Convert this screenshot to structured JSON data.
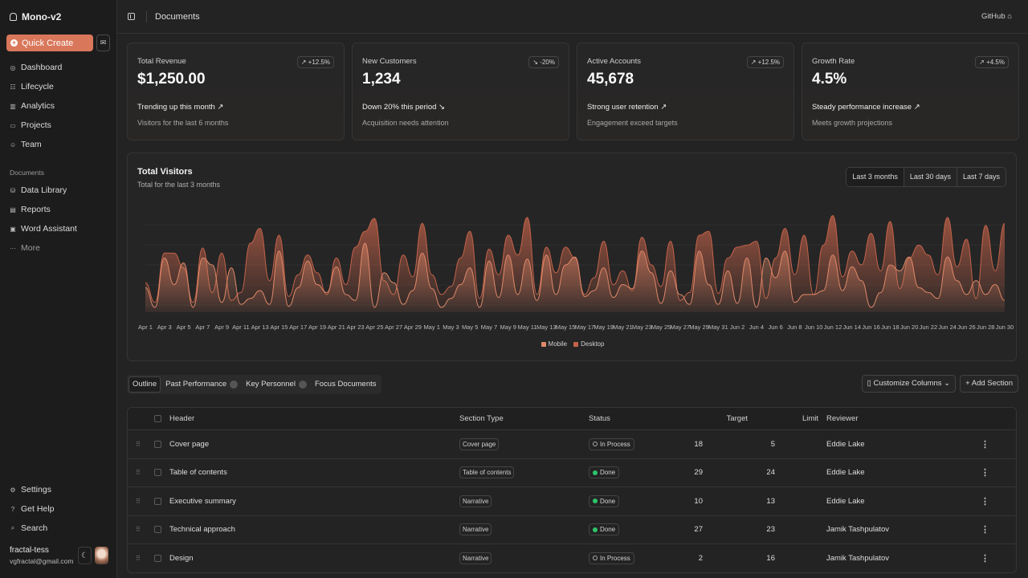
{
  "brand": {
    "name": "Mono-v2"
  },
  "sidebar": {
    "quick_create": "Quick Create",
    "nav": [
      {
        "label": "Dashboard",
        "icon": "dashboard-icon"
      },
      {
        "label": "Lifecycle",
        "icon": "list-icon"
      },
      {
        "label": "Analytics",
        "icon": "chart-icon"
      },
      {
        "label": "Projects",
        "icon": "folder-icon"
      },
      {
        "label": "Team",
        "icon": "users-icon"
      }
    ],
    "documents_label": "Documents",
    "docs": [
      {
        "label": "Data Library",
        "icon": "database-icon"
      },
      {
        "label": "Reports",
        "icon": "report-icon"
      },
      {
        "label": "Word Assistant",
        "icon": "file-word-icon"
      },
      {
        "label": "More",
        "icon": "more-icon"
      }
    ],
    "bottom": [
      {
        "label": "Settings",
        "icon": "gear-icon"
      },
      {
        "label": "Get Help",
        "icon": "help-icon"
      },
      {
        "label": "Search",
        "icon": "search-icon"
      }
    ],
    "user": {
      "name": "fractal-tess",
      "email": "vgfractal@gmail.com"
    }
  },
  "topbar": {
    "title": "Documents",
    "github": "GitHub"
  },
  "cards": [
    {
      "label": "Total Revenue",
      "value": "$1,250.00",
      "badge": "↗ +12.5%",
      "trend": "Trending up this month ↗",
      "sub": "Visitors for the last 6 months"
    },
    {
      "label": "New Customers",
      "value": "1,234",
      "badge": "↘ -20%",
      "trend": "Down 20% this period ↘",
      "sub": "Acquisition needs attention"
    },
    {
      "label": "Active Accounts",
      "value": "45,678",
      "badge": "↗ +12.5%",
      "trend": "Strong user retention ↗",
      "sub": "Engagement exceed targets"
    },
    {
      "label": "Growth Rate",
      "value": "4.5%",
      "badge": "↗ +4.5%",
      "trend": "Steady performance increase ↗",
      "sub": "Meets growth projections"
    }
  ],
  "visitors": {
    "title": "Total Visitors",
    "subtitle": "Total for the last 3 months",
    "ranges": [
      "Last 3 months",
      "Last 30 days",
      "Last 7 days"
    ]
  },
  "chart_data": {
    "type": "area",
    "x_ticks": [
      "Apr 1",
      "Apr 3",
      "Apr 5",
      "Apr 7",
      "Apr 9",
      "Apr 11",
      "Apr 13",
      "Apr 15",
      "Apr 17",
      "Apr 19",
      "Apr 21",
      "Apr 23",
      "Apr 25",
      "Apr 27",
      "Apr 29",
      "May 1",
      "May 3",
      "May 5",
      "May 7",
      "May 9",
      "May 11",
      "May 13",
      "May 15",
      "May 17",
      "May 19",
      "May 21",
      "May 23",
      "May 25",
      "May 27",
      "May 29",
      "May 31",
      "Jun 2",
      "Jun 4",
      "Jun 6",
      "Jun 8",
      "Jun 10",
      "Jun 12",
      "Jun 14",
      "Jun 16",
      "Jun 18",
      "Jun 20",
      "Jun 22",
      "Jun 24",
      "Jun 26",
      "Jun 28",
      "Jun 30"
    ],
    "series": [
      {
        "name": "Mobile",
        "color": "#e0896a",
        "values": [
          0.25,
          0.05,
          0.55,
          0.28,
          0.5,
          0.05,
          0.55,
          0.48,
          0.1,
          0.45,
          0.08,
          0.14,
          0.22,
          0.08,
          0.62,
          0.06,
          0.25,
          0.52,
          0.28,
          0.2,
          0.46,
          0.18,
          0.12,
          0.7,
          0.05,
          0.4,
          0.3,
          0.08,
          0.22,
          0.6,
          0.24,
          0.05,
          0.14,
          0.28,
          0.45,
          0.05,
          0.52,
          0.15,
          0.58,
          0.18,
          0.54,
          0.12,
          0.58,
          0.18,
          0.48,
          0.56,
          0.16,
          0.22,
          0.45,
          0.15,
          0.28,
          0.24,
          0.62,
          0.4,
          0.09,
          0.42,
          0.18,
          0.08,
          0.62,
          0.28,
          0.08,
          0.42,
          0.09,
          0.55,
          0.05,
          0.55,
          0.35,
          0.62,
          0.1,
          0.18,
          0.18,
          0.22,
          0.58,
          0.22,
          0.46,
          0.32,
          0.05,
          0.2,
          0.48,
          0.42,
          0.56,
          0.25,
          0.2,
          0.14,
          0.56,
          0.32,
          0.18,
          0.32,
          0.18,
          0.28,
          0.12
        ]
      },
      {
        "name": "Desktop",
        "color": "#c4634a",
        "values": [
          0.3,
          0.1,
          0.6,
          0.6,
          0.45,
          0.1,
          0.65,
          0.2,
          0.6,
          0.12,
          0.2,
          0.7,
          0.85,
          0.32,
          0.78,
          0.16,
          0.38,
          0.58,
          0.4,
          0.18,
          0.55,
          0.28,
          0.66,
          0.82,
          0.95,
          0.32,
          0.18,
          0.58,
          0.36,
          0.9,
          0.38,
          0.18,
          0.26,
          0.55,
          0.82,
          0.14,
          0.64,
          0.38,
          0.78,
          0.58,
          0.96,
          0.18,
          0.66,
          0.4,
          0.66,
          0.55,
          0.18,
          0.35,
          0.72,
          0.28,
          0.42,
          0.22,
          0.76,
          0.48,
          0.26,
          0.72,
          0.12,
          0.2,
          0.78,
          0.82,
          0.19,
          0.55,
          0.66,
          0.68,
          0.72,
          0.14,
          0.55,
          0.85,
          0.38,
          0.78,
          0.18,
          0.68,
          0.98,
          0.36,
          0.62,
          0.48,
          0.8,
          0.42,
          0.92,
          0.24,
          0.55,
          0.68,
          0.58,
          0.38,
          0.96,
          0.46,
          0.74,
          0.14,
          0.88,
          0.42,
          0.9
        ]
      }
    ],
    "legend": [
      "Mobile",
      "Desktop"
    ],
    "grid": true
  },
  "tabs": [
    {
      "label": "Outline"
    },
    {
      "label": "Past Performance"
    },
    {
      "label": "Key Personnel"
    },
    {
      "label": "Focus Documents"
    }
  ],
  "actions": {
    "customize": "Customize Columns",
    "add": "+ Add Section"
  },
  "table": {
    "columns": [
      "Header",
      "Section Type",
      "Status",
      "Target",
      "Limit",
      "Reviewer"
    ],
    "rows": [
      {
        "header": "Cover page",
        "type": "Cover page",
        "status": "In Process",
        "done": false,
        "target": "18",
        "limit": "5",
        "reviewer": "Eddie Lake"
      },
      {
        "header": "Table of contents",
        "type": "Table of contents",
        "status": "Done",
        "done": true,
        "target": "29",
        "limit": "24",
        "reviewer": "Eddie Lake"
      },
      {
        "header": "Executive summary",
        "type": "Narrative",
        "status": "Done",
        "done": true,
        "target": "10",
        "limit": "13",
        "reviewer": "Eddie Lake"
      },
      {
        "header": "Technical approach",
        "type": "Narrative",
        "status": "Done",
        "done": true,
        "target": "27",
        "limit": "23",
        "reviewer": "Jamik Tashpulatov"
      },
      {
        "header": "Design",
        "type": "Narrative",
        "status": "In Process",
        "done": false,
        "target": "2",
        "limit": "16",
        "reviewer": "Jamik Tashpulatov"
      }
    ]
  }
}
